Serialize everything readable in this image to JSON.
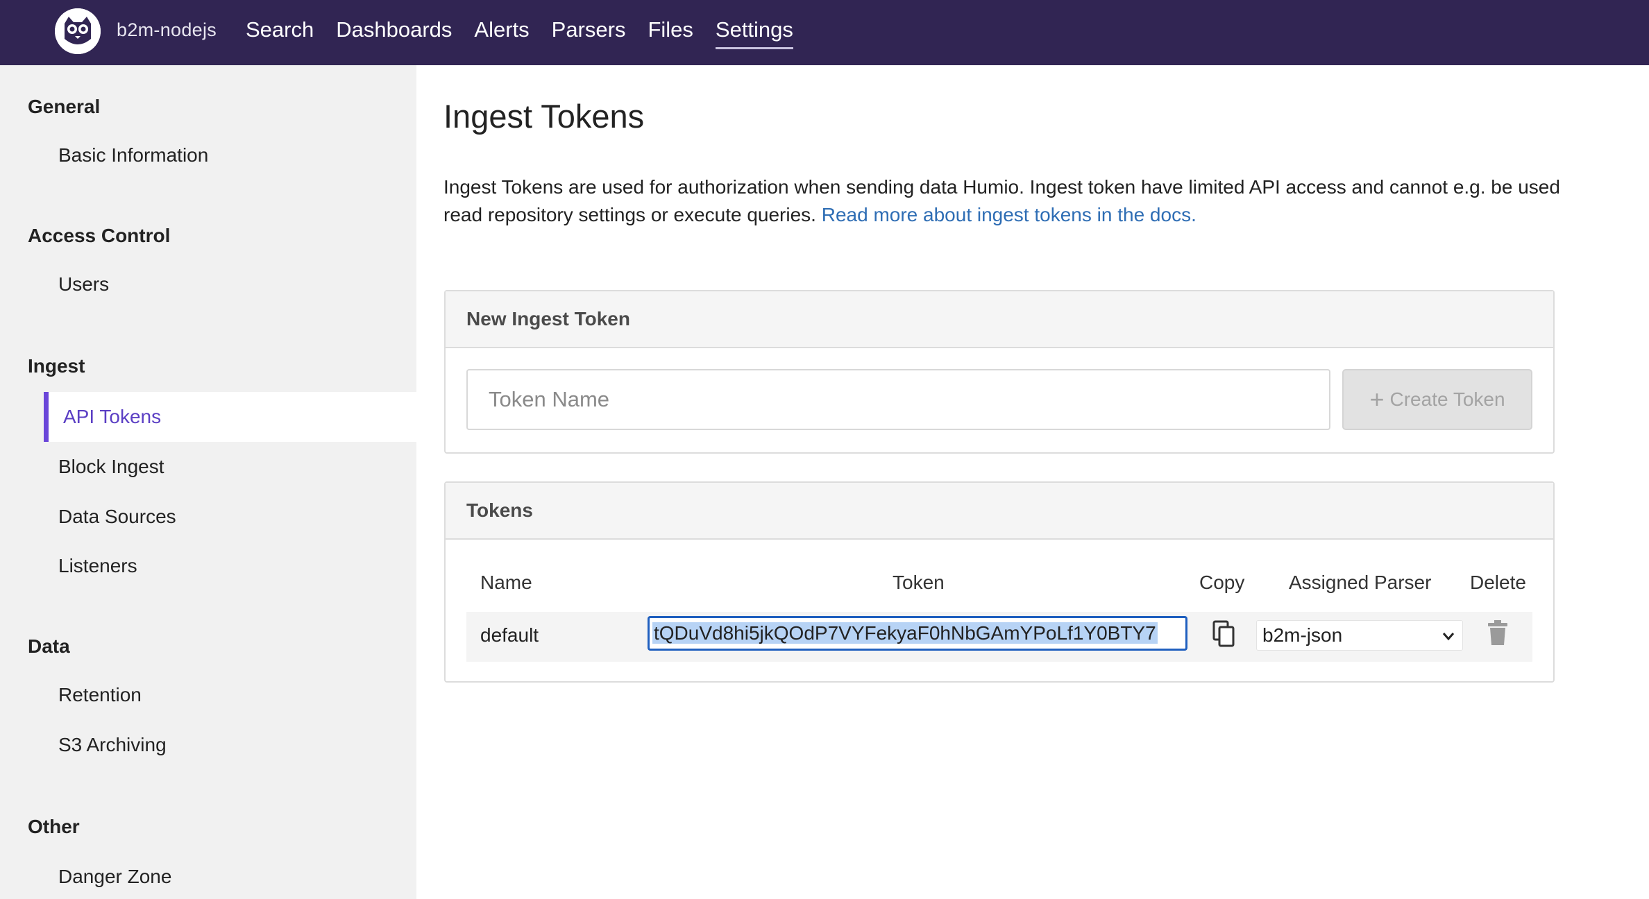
{
  "header": {
    "repo_name": "b2m-nodejs",
    "nav": [
      {
        "label": "Search"
      },
      {
        "label": "Dashboards"
      },
      {
        "label": "Alerts"
      },
      {
        "label": "Parsers"
      },
      {
        "label": "Files"
      },
      {
        "label": "Settings",
        "active": true
      }
    ],
    "brand_color": "#312553"
  },
  "sidebar": {
    "sections": {
      "general": {
        "title": "General",
        "items": [
          "Basic Information"
        ]
      },
      "access": {
        "title": "Access Control",
        "items": [
          "Users"
        ]
      },
      "ingest": {
        "title": "Ingest",
        "items": [
          "API Tokens",
          "Block Ingest",
          "Data Sources",
          "Listeners"
        ]
      },
      "data": {
        "title": "Data",
        "items": [
          "Retention",
          "S3 Archiving"
        ]
      },
      "other": {
        "title": "Other",
        "items": [
          "Danger Zone"
        ]
      }
    },
    "active_item": "API Tokens",
    "accent_color": "#6a46d9"
  },
  "main": {
    "title": "Ingest Tokens",
    "description": "Ingest Tokens are used for authorization when sending data Humio. Ingest token have limited API access and cannot e.g. be used read repository settings or execute queries.",
    "docs_link": "Read more about ingest tokens in the docs.",
    "new_token": {
      "title": "New Ingest Token",
      "input_placeholder": "Token Name",
      "input_value": "",
      "create_label": "Create Token"
    },
    "tokens": {
      "title": "Tokens",
      "columns": {
        "name": "Name",
        "token": "Token",
        "copy": "Copy",
        "parser": "Assigned Parser",
        "delete": "Delete"
      },
      "rows": [
        {
          "name": "default",
          "token": "tQDuVd8hi5jkQOdP7VYFekyaF0hNbGAmYPoLf1Y0BTY7",
          "parser": "b2m-json"
        }
      ]
    }
  }
}
